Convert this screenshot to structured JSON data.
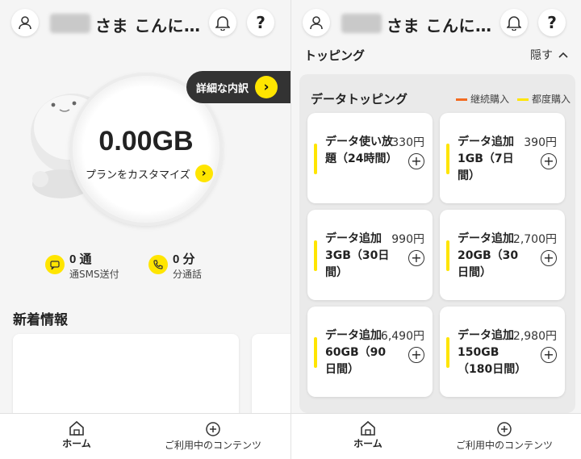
{
  "header": {
    "greeting": "さま こんに…"
  },
  "left": {
    "detail_button": "詳細な内訳",
    "data_amount": "0.00GB",
    "plan_link": "プランをカスタマイズ",
    "sms": {
      "value": "0 通",
      "label": "通SMS送付"
    },
    "call": {
      "value": "0 分",
      "label": "分通話"
    },
    "news_title": "新着情報"
  },
  "right": {
    "section_title": "トッピング",
    "hide_label": "隠す",
    "box_title": "データトッピング",
    "legend": [
      {
        "label": "継続購入",
        "color": "#f26b21"
      },
      {
        "label": "都度購入",
        "color": "#ffe500"
      }
    ],
    "cards": [
      {
        "name": "データ使い放題（24時間）",
        "price": "330円"
      },
      {
        "name": "データ追加1GB（7日間）",
        "price": "390円"
      },
      {
        "name": "データ追加3GB（30日間）",
        "price": "990円"
      },
      {
        "name": "データ追加20GB（30日間）",
        "price": "2,700円"
      },
      {
        "name": "データ追加60GB（90日間）",
        "price": "6,490円"
      },
      {
        "name": "データ追加150GB（180日間）",
        "price": "12,980円"
      }
    ]
  },
  "nav": {
    "home": "ホーム",
    "content": "ご利用中のコンテンツ"
  },
  "colors": {
    "accent": "#ffe500",
    "dark": "#333333"
  }
}
